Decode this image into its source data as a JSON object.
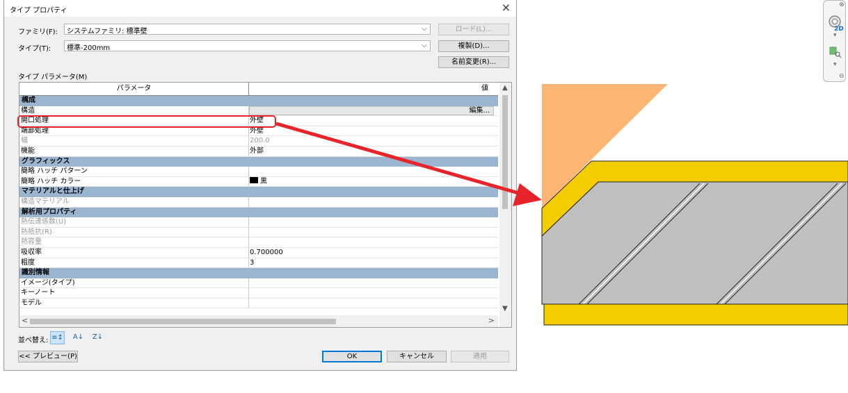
{
  "dialog": {
    "title": "タイプ プロパティ",
    "close_symbol": "×",
    "family_label": "ファミリ(F):",
    "family_value": "システムファミリ: 標準壁",
    "type_label": "タイプ(T):",
    "type_value": "標準-200mm",
    "load_button": "ロード(L)...",
    "duplicate_button": "複製(D)...",
    "rename_button": "名前変更(R)...",
    "type_params_label": "タイプ パラメータ(M)",
    "grid_header": {
      "param": "パラメータ",
      "value": "値"
    },
    "sort_label": "並べ替え:",
    "preview_button": "<< プレビュー(P)",
    "ok_button": "OK",
    "cancel_button": "キャンセル",
    "apply_button": "適用",
    "params": [
      {
        "kind": "group",
        "label": "構成"
      },
      {
        "kind": "edit",
        "label": "構造",
        "value": "編集..."
      },
      {
        "kind": "row",
        "label": "開口処理",
        "value": "外壁"
      },
      {
        "kind": "row",
        "label": "端部処理",
        "value": "外壁"
      },
      {
        "kind": "dim",
        "label": "幅",
        "value": "200.0"
      },
      {
        "kind": "row",
        "label": "機能",
        "value": "外部"
      },
      {
        "kind": "group",
        "label": "グラフィックス"
      },
      {
        "kind": "row",
        "label": "簡略 ハッチ パターン",
        "value": ""
      },
      {
        "kind": "color",
        "label": "簡略 ハッチ カラー",
        "value": "黒"
      },
      {
        "kind": "group",
        "label": "マテリアルと仕上げ"
      },
      {
        "kind": "dim",
        "label": "構造マテリアル",
        "value": ""
      },
      {
        "kind": "group",
        "label": "解析用プロパティ"
      },
      {
        "kind": "dim",
        "label": "熱伝達係数(U)",
        "value": ""
      },
      {
        "kind": "dim",
        "label": "熱抵抗(R)",
        "value": ""
      },
      {
        "kind": "dim",
        "label": "熱容量",
        "value": ""
      },
      {
        "kind": "row",
        "label": "吸収率",
        "value": "0.700000"
      },
      {
        "kind": "row",
        "label": "粗度",
        "value": "3"
      },
      {
        "kind": "group",
        "label": "識別情報"
      },
      {
        "kind": "row",
        "label": "イメージ(タイプ)",
        "value": ""
      },
      {
        "kind": "row",
        "label": "キーノート",
        "value": ""
      },
      {
        "kind": "row",
        "label": "モデル",
        "value": ""
      }
    ]
  },
  "icons": {
    "combo_arrow": "⌵",
    "scroll_up": "▲",
    "scroll_down": "▼",
    "scroll_left": "<",
    "scroll_right": ">",
    "sort_group": "≡↕",
    "sort_az": "A↓",
    "sort_za": "Z↓"
  },
  "nav_bar": {
    "label_2d": "2D"
  },
  "colors": {
    "group_row": "#9bb4d0",
    "highlight": "#e8242b",
    "wall_core": "#c0c0c0",
    "wall_finish": "#f5cc00",
    "opening_triangle": "#fbb676"
  }
}
